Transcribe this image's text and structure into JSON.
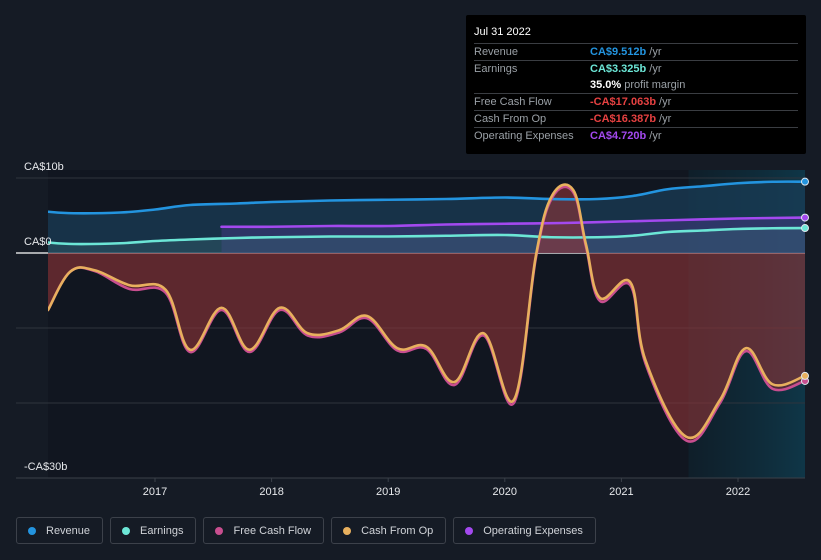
{
  "tooltip": {
    "date": "Jul 31 2022",
    "rows": [
      {
        "label": "Revenue",
        "value": "CA$9.512b",
        "unit": "/yr",
        "color": "#2394df"
      },
      {
        "label": "Earnings",
        "value": "CA$3.325b",
        "unit": "/yr",
        "color": "#6ce6d6"
      },
      {
        "label": "",
        "value": "35.0%",
        "unit": "profit margin",
        "color": "#ffffff"
      },
      {
        "label": "Free Cash Flow",
        "value": "-CA$17.063b",
        "unit": "/yr",
        "color": "#e64141"
      },
      {
        "label": "Cash From Op",
        "value": "-CA$16.387b",
        "unit": "/yr",
        "color": "#e64141"
      },
      {
        "label": "Operating Expenses",
        "value": "CA$4.720b",
        "unit": "/yr",
        "color": "#a349ef"
      }
    ]
  },
  "legend": [
    {
      "label": "Revenue",
      "color": "#2394df"
    },
    {
      "label": "Earnings",
      "color": "#6ce6d6"
    },
    {
      "label": "Free Cash Flow",
      "color": "#c84e8f"
    },
    {
      "label": "Cash From Op",
      "color": "#e8b05e"
    },
    {
      "label": "Operating Expenses",
      "color": "#a349ef"
    }
  ],
  "chart_data": {
    "type": "line",
    "title": "",
    "xlabel": "",
    "ylabel": "",
    "currency_unit": "CA$ billions",
    "ylim": [
      -30,
      10
    ],
    "xlim": [
      2016.08,
      2022.58
    ],
    "y_tick_labels": [
      {
        "value": 10,
        "label": "CA$10b"
      },
      {
        "value": 0,
        "label": "CA$0"
      },
      {
        "value": -30,
        "label": "-CA$30b"
      }
    ],
    "gridlines": [
      10,
      0,
      -10,
      -20
    ],
    "x_ticks": [
      {
        "value": 2017,
        "label": "2017"
      },
      {
        "value": 2018,
        "label": "2018"
      },
      {
        "value": 2019,
        "label": "2019"
      },
      {
        "value": 2020,
        "label": "2020"
      },
      {
        "value": 2021,
        "label": "2021"
      },
      {
        "value": 2022,
        "label": "2022"
      }
    ],
    "highlight_from": 2021.58,
    "series": [
      {
        "name": "Revenue",
        "color": "#2394df",
        "x": [
          2016.08,
          2016.3,
          2016.7,
          2017.0,
          2017.3,
          2017.7,
          2018.0,
          2018.5,
          2019.0,
          2019.5,
          2020.0,
          2020.4,
          2020.8,
          2021.1,
          2021.4,
          2021.7,
          2022.0,
          2022.3,
          2022.58
        ],
        "y": [
          5.5,
          5.3,
          5.4,
          5.8,
          6.4,
          6.6,
          6.8,
          7.0,
          7.1,
          7.2,
          7.4,
          7.2,
          7.2,
          7.6,
          8.5,
          8.9,
          9.3,
          9.5,
          9.51
        ]
      },
      {
        "name": "Earnings",
        "color": "#6ce6d6",
        "x": [
          2016.08,
          2016.3,
          2016.7,
          2017.0,
          2017.3,
          2017.7,
          2018.0,
          2018.5,
          2019.0,
          2019.5,
          2020.0,
          2020.4,
          2020.8,
          2021.1,
          2021.4,
          2021.7,
          2022.0,
          2022.3,
          2022.58
        ],
        "y": [
          1.4,
          1.2,
          1.3,
          1.6,
          1.8,
          2.0,
          2.1,
          2.2,
          2.2,
          2.3,
          2.4,
          2.1,
          2.1,
          2.3,
          2.8,
          3.0,
          3.2,
          3.3,
          3.33
        ]
      },
      {
        "name": "Operating Expenses",
        "color": "#a349ef",
        "x": [
          2017.57,
          2018.0,
          2018.5,
          2019.0,
          2019.5,
          2020.0,
          2020.5,
          2021.0,
          2021.5,
          2022.0,
          2022.58
        ],
        "y": [
          3.5,
          3.5,
          3.6,
          3.6,
          3.8,
          3.9,
          4.0,
          4.2,
          4.4,
          4.6,
          4.72
        ]
      },
      {
        "name": "Free Cash Flow",
        "color": "#c84e8f",
        "x": [
          2016.08,
          2016.27,
          2016.48,
          2016.78,
          2017.09,
          2017.3,
          2017.57,
          2017.81,
          2018.07,
          2018.31,
          2018.58,
          2018.82,
          2019.08,
          2019.33,
          2019.57,
          2019.82,
          2020.08,
          2020.27,
          2020.41,
          2020.59,
          2020.7,
          2020.82,
          2021.08,
          2021.21,
          2021.56,
          2021.85,
          2022.07,
          2022.3,
          2022.58
        ],
        "y": [
          -7.6,
          -2.5,
          -2.4,
          -4.8,
          -5.3,
          -13.2,
          -7.6,
          -13.2,
          -7.6,
          -11.0,
          -10.6,
          -8.7,
          -13.0,
          -12.8,
          -17.6,
          -11.0,
          -20.0,
          -0.6,
          7.4,
          8.1,
          0.8,
          -6.4,
          -4.3,
          -14.7,
          -25.0,
          -20.0,
          -13.1,
          -18.1,
          -17.06
        ]
      },
      {
        "name": "Cash From Op",
        "color": "#e8b05e",
        "x": [
          2016.08,
          2016.27,
          2016.48,
          2016.78,
          2017.09,
          2017.3,
          2017.57,
          2017.81,
          2018.07,
          2018.31,
          2018.58,
          2018.82,
          2019.08,
          2019.33,
          2019.57,
          2019.82,
          2020.08,
          2020.27,
          2020.41,
          2020.59,
          2020.7,
          2020.82,
          2021.08,
          2021.21,
          2021.56,
          2021.85,
          2022.07,
          2022.3,
          2022.58
        ],
        "y": [
          -7.6,
          -2.5,
          -2.3,
          -4.3,
          -4.9,
          -12.9,
          -7.3,
          -12.9,
          -7.3,
          -10.7,
          -10.3,
          -8.4,
          -12.7,
          -12.5,
          -17.2,
          -10.7,
          -19.6,
          -0.3,
          7.7,
          8.4,
          1.1,
          -6.0,
          -3.9,
          -14.3,
          -24.5,
          -19.6,
          -12.7,
          -17.5,
          -16.39
        ]
      }
    ]
  }
}
